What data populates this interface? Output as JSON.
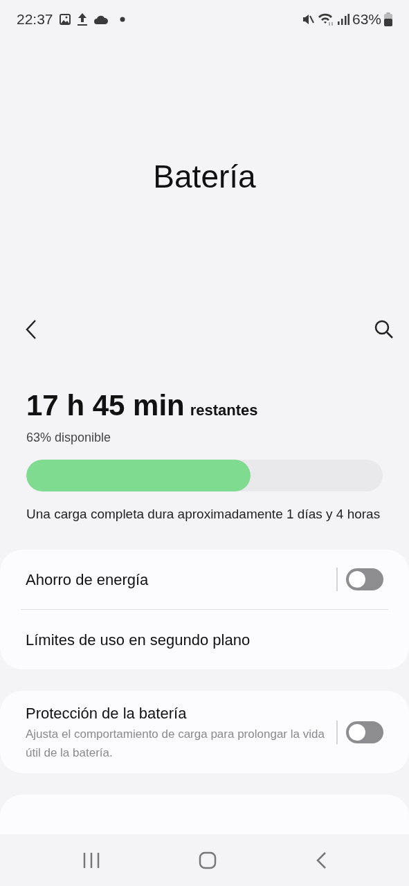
{
  "status_bar": {
    "time": "22:37",
    "battery": "63%"
  },
  "title": "Batería",
  "battery": {
    "remaining": "17 h 45 min",
    "suffix": "restantes",
    "available": "63% disponible",
    "level": 0.63,
    "note": "Una carga completa dura aproximadamente 1 días y 4 horas"
  },
  "cards": [
    {
      "items": [
        {
          "kind": "toggle",
          "label": "Ahorro de energía",
          "on": false
        },
        {
          "kind": "link",
          "label": "Límites de uso en segundo plano"
        }
      ]
    },
    {
      "items": [
        {
          "kind": "toggle",
          "label": "Protección de la batería",
          "subtitle": "Ajusta el comportamiento de carga para prolongar la vida útil de la batería.",
          "on": false
        }
      ]
    }
  ]
}
